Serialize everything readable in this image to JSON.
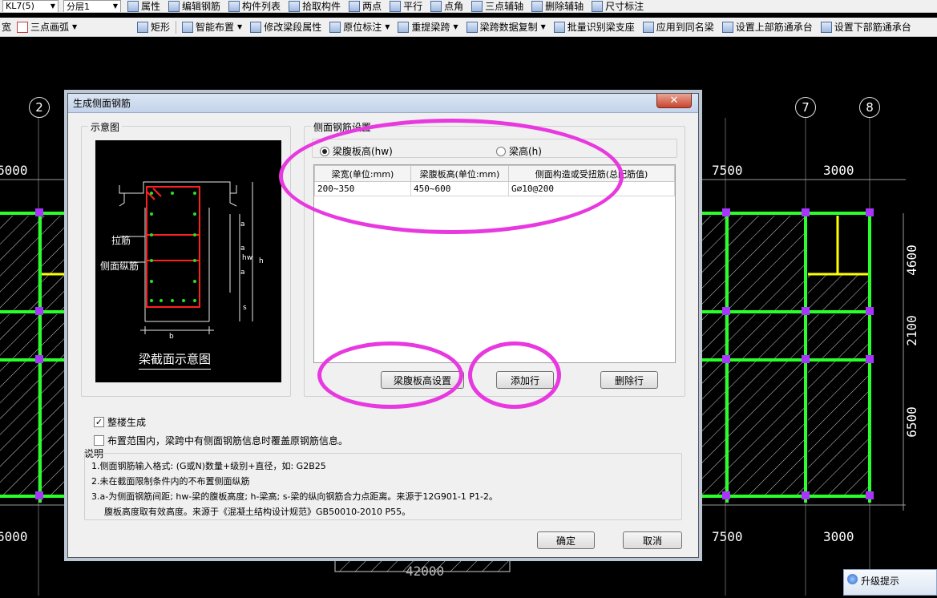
{
  "toolbar1": {
    "combo_beam": "KL7(5)",
    "combo_layer": "分层1",
    "items": [
      "属性",
      "编辑钢筋",
      "构件列表",
      "拾取构件",
      "两点",
      "平行",
      "点角",
      "三点辅轴",
      "删除辅轴",
      "尺寸标注"
    ]
  },
  "toolbar2": {
    "lead": "宽",
    "arc_combo": "三点画弧",
    "items": [
      "矩形",
      "智能布置",
      "修改梁段属性",
      "原位标注",
      "重提梁跨",
      "梁跨数据复制",
      "批量识别梁支座",
      "应用到同名梁",
      "设置上部筋通承台",
      "设置下部筋通承台"
    ]
  },
  "canvas": {
    "axis_labels": [
      "2",
      "7",
      "8"
    ],
    "dims_top": [
      "6000",
      "7500",
      "3000"
    ],
    "dims_bottom": [
      "6000",
      "7500",
      "3000"
    ],
    "dims_right": [
      "4600",
      "2100",
      "6500"
    ],
    "dim_total": "42000",
    "colors": {
      "beam": "#00ff00",
      "wall": "#ffff00",
      "node": "#aa00ff"
    }
  },
  "dialog": {
    "title": "生成侧面钢筋",
    "close_glyph": "✕",
    "diagram": {
      "legend": "示意图",
      "caption": "梁截面示意图",
      "label_tie": "拉筋",
      "label_side": "侧面纵筋",
      "labels_dim": {
        "a": "a",
        "hw": "hw",
        "h": "h",
        "s": "s",
        "b": "b"
      }
    },
    "settings": {
      "legend": "侧面钢筋设置",
      "radio_hw": "梁腹板高(hw)",
      "radio_h": "梁高(h)",
      "radio_selected": "hw",
      "columns": [
        "梁宽(单位:mm)",
        "梁腹板高(单位:mm)",
        "侧面构造或受扭筋(总配筋值)"
      ],
      "rows": [
        [
          "200~350",
          "450~600",
          "G⌀10@200"
        ]
      ]
    },
    "buttons": {
      "web_height": "梁腹板高设置",
      "add_row": "添加行",
      "delete_row": "删除行",
      "ok": "确定",
      "cancel": "取消"
    },
    "options": {
      "whole_floor": "整楼生成",
      "whole_floor_checked": true,
      "overwrite": "布置范围内，梁跨中有侧面钢筋信息时覆盖原钢筋信息。",
      "overwrite_checked": false
    },
    "notes": {
      "title": "说明",
      "lines": [
        "1.侧面钢筋输入格式: (G或N)数量+级别+直径，如: G2B25",
        "2.未在截面限制条件内的不布置侧面纵筋",
        "3.a-为侧面钢筋间距; hw-梁的腹板高度; h-梁高; s-梁的纵向钢筋合力点距离。来源于12G901-1 P1-2。",
        "腹板高度取有效高度。来源于《混凝土结构设计规范》GB50010-2010 P55。"
      ]
    }
  },
  "upgrade": {
    "label": "升级提示"
  }
}
